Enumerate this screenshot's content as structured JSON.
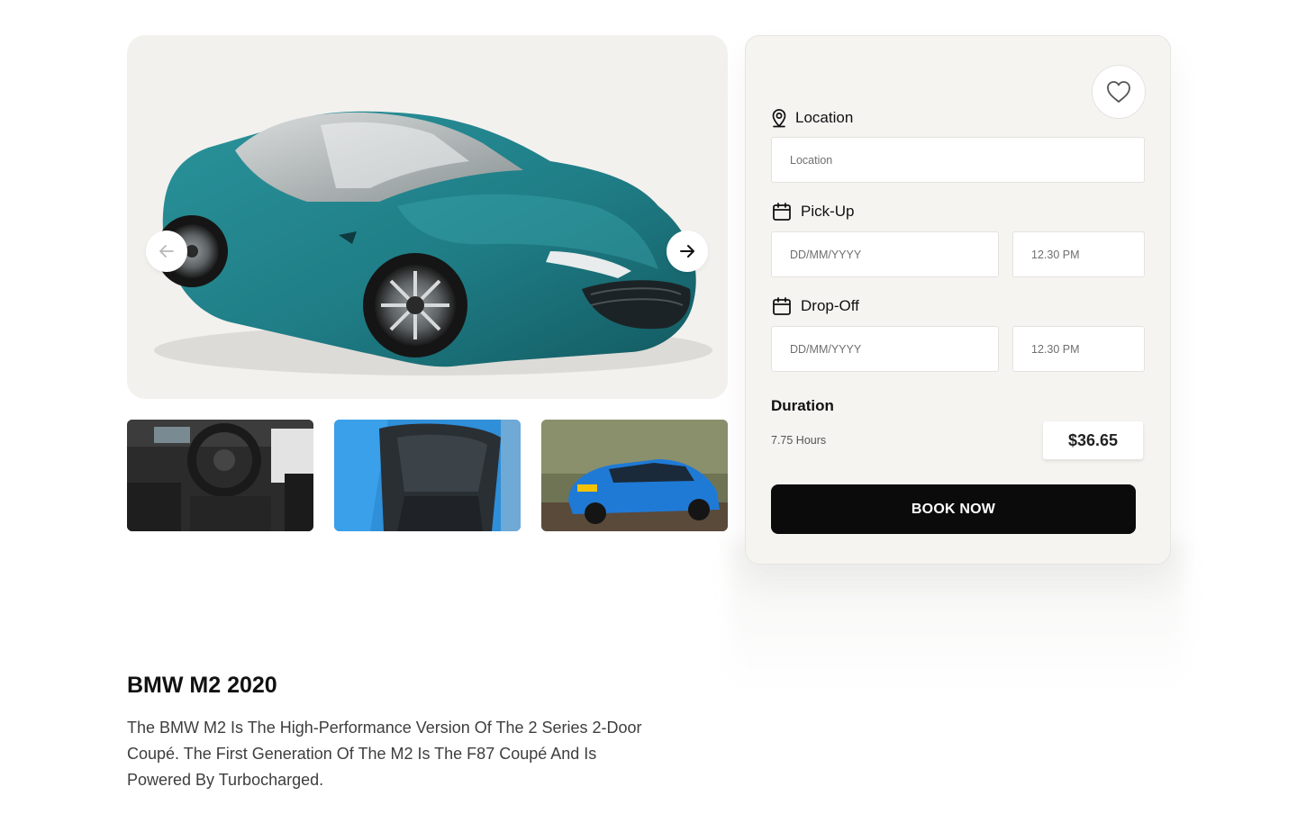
{
  "gallery": {
    "main_image": "teal-sports-car-photo",
    "prev_icon": "arrow-left-icon",
    "next_icon": "arrow-right-icon",
    "thumbnails": [
      {
        "image": "car-dashboard-interior-photo"
      },
      {
        "image": "car-rear-seats-photo"
      },
      {
        "image": "blue-hatchback-driving-photo"
      }
    ]
  },
  "booking": {
    "favorite_icon": "heart-icon",
    "location": {
      "label": "Location",
      "icon": "map-pin-icon",
      "placeholder": "Location"
    },
    "pickup": {
      "label": "Pick-Up",
      "icon": "calendar-icon",
      "date_placeholder": "DD/MM/YYYY",
      "time_placeholder": "12.30 PM"
    },
    "dropoff": {
      "label": "Drop-Off",
      "icon": "calendar-icon",
      "date_placeholder": "DD/MM/YYYY",
      "time_placeholder": "12.30 PM"
    },
    "duration": {
      "label": "Duration",
      "hours": "7.75 Hours",
      "price": "$36.65"
    },
    "book_button": "BOOK NOW"
  },
  "car": {
    "title": "BMW M2 2020",
    "description": "The BMW M2 Is The High-Performance Version Of The 2 Series 2-Door Coupé. The First Generation Of The M2 Is The F87 Coupé And Is Powered By Turbocharged."
  },
  "colors": {
    "panel_bg": "#f5f4f1",
    "hero_bg": "#f2f1ee",
    "car_teal": "#1f7d86",
    "button_bg": "#0b0b0b"
  }
}
